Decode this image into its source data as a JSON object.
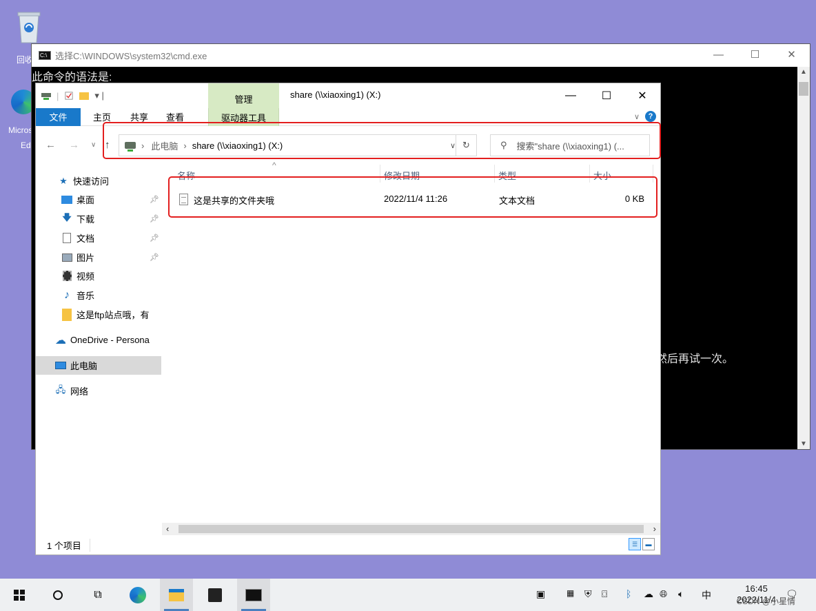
{
  "desktop": {
    "recycle_label": "回收站",
    "edge_label_1": "Microsoft",
    "edge_label_2": "Edge"
  },
  "cmd": {
    "title": "选择C:\\WINDOWS\\system32\\cmd.exe",
    "line1": "此命令的语法是:",
    "line_right": "然后再试一次。",
    "minimize": "—",
    "maximize": "☐",
    "close": "✕"
  },
  "explorer": {
    "title": "share (\\\\xiaoxing1) (X:)",
    "manage_tab": "管理",
    "drive_tools_tab": "驱动器工具",
    "ribbon_tabs": [
      "文件",
      "主页",
      "共享",
      "查看"
    ],
    "address": {
      "root": "此电脑",
      "current": "share (\\\\xiaoxing1) (X:)"
    },
    "search_placeholder": "搜索\"share (\\\\xiaoxing1) (...",
    "sidebar": {
      "quick_access": "快速访问",
      "items": [
        "桌面",
        "下载",
        "文档",
        "图片",
        "视频",
        "音乐",
        "这是ftp站点哦，有"
      ],
      "onedrive": "OneDrive - Persona",
      "this_pc": "此电脑",
      "network": "网络"
    },
    "columns": [
      "名称",
      "修改日期",
      "类型",
      "大小"
    ],
    "files": [
      {
        "name": "这是共享的文件夹哦",
        "modified": "2022/11/4 11:26",
        "type": "文本文档",
        "size": "0 KB"
      }
    ],
    "status": "1 个项目",
    "controls": {
      "minimize": "—",
      "maximize": "☐",
      "close": "✕"
    }
  },
  "taskbar": {
    "time": "16:45",
    "date": "2022/11/4",
    "ime": "中",
    "watermark": "CSDN @小星情"
  },
  "colors": {
    "desktop_bg": "#8f8bd6",
    "file_tab": "#1979ca",
    "manage_tab": "#d7eac4",
    "highlight_red": "#e31e1e"
  }
}
